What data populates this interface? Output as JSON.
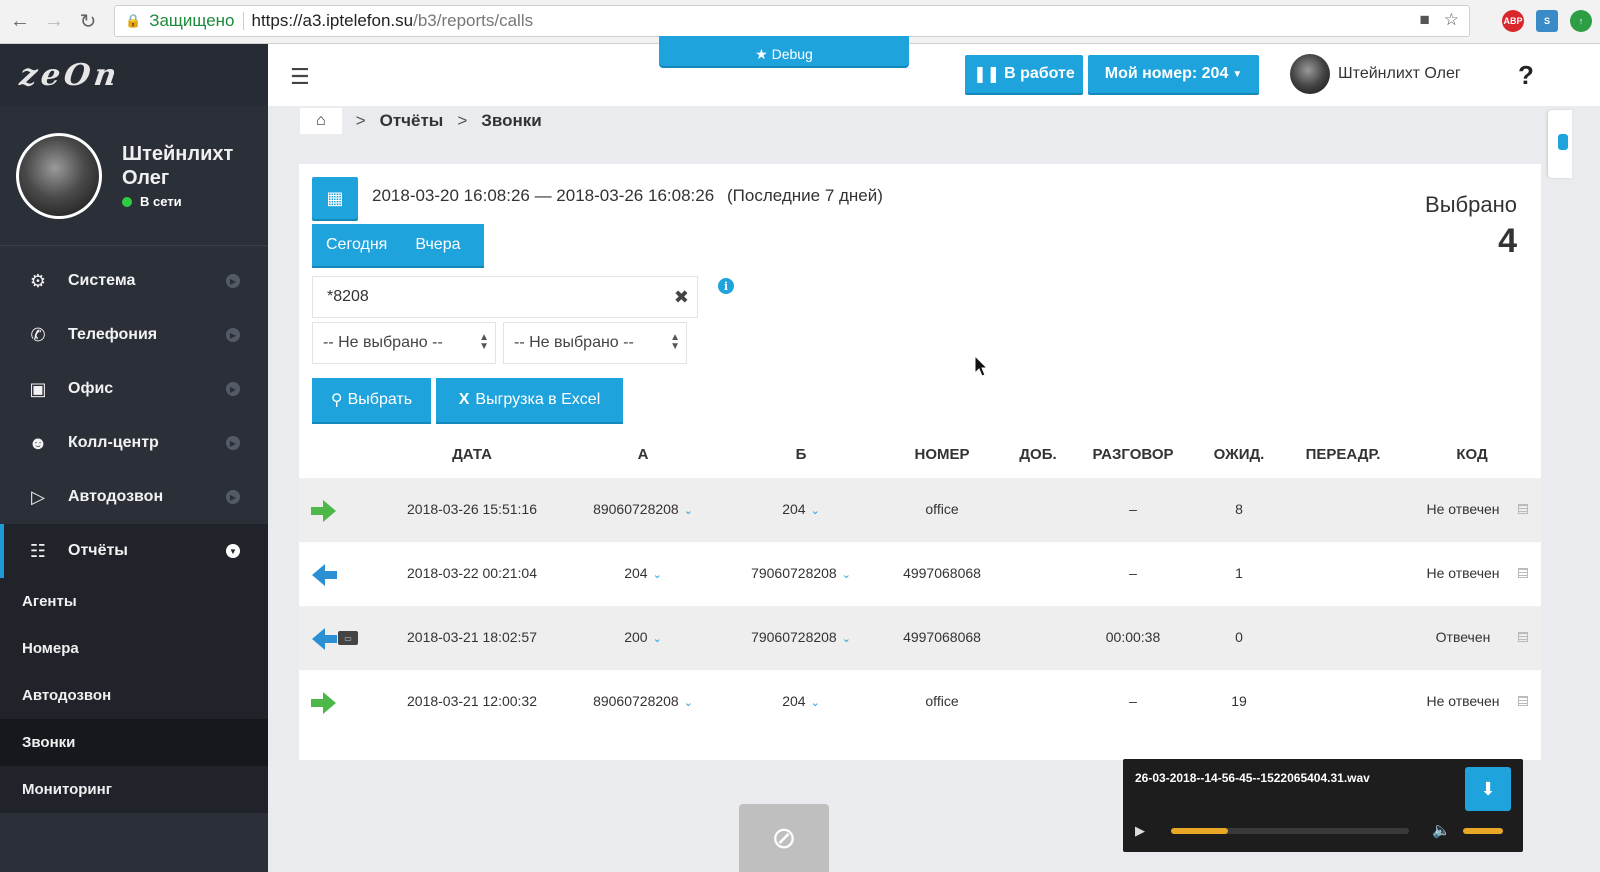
{
  "browser": {
    "secure_label": "Защищено",
    "url_host": "https://a3.iptelefon.su",
    "url_path": "/b3/reports/calls"
  },
  "sidebar": {
    "logo": "zeOn",
    "user_name": "Штейнлихт Олег",
    "user_status": "В сети",
    "items": [
      {
        "label": "Система",
        "icon": "gears-icon"
      },
      {
        "label": "Телефония",
        "icon": "phone-icon"
      },
      {
        "label": "Офис",
        "icon": "briefcase-icon"
      },
      {
        "label": "Колл-центр",
        "icon": "users-icon"
      },
      {
        "label": "Автодозвон",
        "icon": "play-circle-icon"
      },
      {
        "label": "Отчёты",
        "icon": "document-icon"
      }
    ],
    "subitems": [
      "Агенты",
      "Номера",
      "Автодозвон",
      "Звонки",
      "Мониторинг"
    ]
  },
  "topbar": {
    "debug_label": "★ Debug",
    "work_label": "В работе",
    "my_number_label": "Мой номер: 204",
    "user_name": "Штейнлихт Олег",
    "help": "?"
  },
  "breadcrumb": {
    "items": [
      "Отчёты",
      "Звонки"
    ]
  },
  "filter": {
    "range_text": "2018-03-20 16:08:26 — 2018-03-26 16:08:26",
    "range_note": "(Последние 7 дней)",
    "today": "Сегодня",
    "yesterday": "Вчера",
    "search_value": "*8208",
    "select1": "-- Не выбрано --",
    "select2": "-- Не выбрано --",
    "select_btn": "Выбрать",
    "excel_btn": "Выгрузка в Excel",
    "selected_label": "Выбрано",
    "selected_count": "4"
  },
  "table": {
    "headers": [
      "ДАТА",
      "А",
      "Б",
      "НОМЕР",
      "ДОБ.",
      "РАЗГОВОР",
      "ОЖИД.",
      "ПЕРЕАДР.",
      "КОД"
    ],
    "rows": [
      {
        "direction": "incoming",
        "date": "2018-03-26 15:51:16",
        "a": "89060728208",
        "b": "204",
        "number": "office",
        "ext": "",
        "talk": "–",
        "wait": "8",
        "redirect": "",
        "code": "Не отвечен",
        "record": false
      },
      {
        "direction": "outgoing",
        "date": "2018-03-22 00:21:04",
        "a": "204",
        "b": "79060728208",
        "number": "4997068068",
        "ext": "",
        "talk": "–",
        "wait": "1",
        "redirect": "",
        "code": "Не отвечен",
        "record": false
      },
      {
        "direction": "outgoing",
        "date": "2018-03-21 18:02:57",
        "a": "200",
        "b": "79060728208",
        "number": "4997068068",
        "ext": "",
        "talk": "00:00:38",
        "wait": "0",
        "redirect": "",
        "code": "Отвечен",
        "record": true
      },
      {
        "direction": "incoming",
        "date": "2018-03-21 12:00:32",
        "a": "89060728208",
        "b": "204",
        "number": "office",
        "ext": "",
        "talk": "–",
        "wait": "19",
        "redirect": "",
        "code": "Не отвечен",
        "record": false
      }
    ]
  },
  "player": {
    "filename": "26-03-2018--14-56-45--1522065404.31.wav",
    "progress_fraction": 0.24,
    "volume_fraction": 1.0
  },
  "colors": {
    "accent": "#1fa3dd",
    "sidebar": "#2b2f38",
    "incoming": "#4cb848",
    "outgoing": "#2c8fd3"
  }
}
